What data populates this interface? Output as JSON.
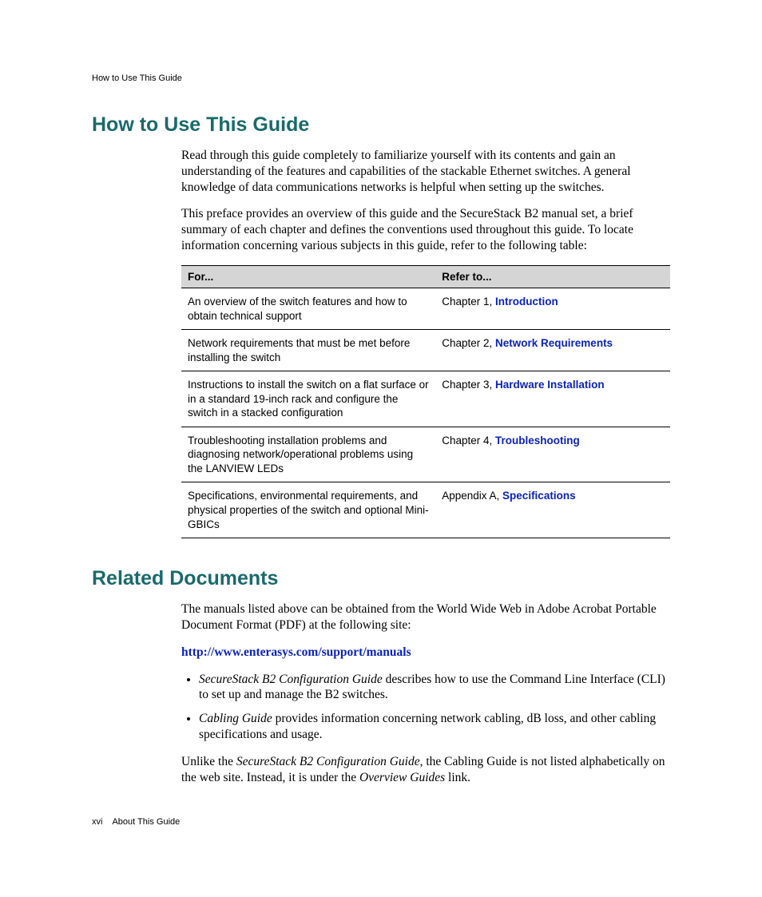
{
  "header": {
    "running": "How to Use This Guide"
  },
  "section1": {
    "title": "How to Use This Guide",
    "para1": "Read through this guide completely to familiarize yourself with its contents and gain an understanding of the features and capabilities of the stackable Ethernet switches. A general knowledge of data communications networks is helpful when setting up the switches.",
    "para2": "This preface provides an overview of this guide and the SecureStack B2 manual set, a brief summary of each chapter and defines the conventions used throughout this guide. To locate information concerning various subjects in this guide, refer to the following table:"
  },
  "table": {
    "head_for": "For...",
    "head_refer": "Refer to...",
    "rows": [
      {
        "for": "An overview of the switch features and how to obtain technical support",
        "ref_prefix": "Chapter 1, ",
        "ref_link": "Introduction"
      },
      {
        "for": "Network requirements that must be met before installing the switch",
        "ref_prefix": "Chapter 2, ",
        "ref_link": "Network Requirements"
      },
      {
        "for": "Instructions to install the switch on a flat surface or in a standard 19-inch rack and configure the switch in a stacked configuration",
        "ref_prefix": "Chapter 3, ",
        "ref_link": "Hardware Installation"
      },
      {
        "for": "Troubleshooting installation problems and diagnosing network/operational problems using the LANVIEW LEDs",
        "ref_prefix": "Chapter 4, ",
        "ref_link": "Troubleshooting"
      },
      {
        "for": "Specifications, environmental requirements, and physical properties of the switch and optional Mini-GBICs",
        "ref_prefix": "Appendix A, ",
        "ref_link": "Specifications"
      }
    ]
  },
  "section2": {
    "title": "Related Documents",
    "para1": "The manuals listed above can be obtained from the World Wide Web in Adobe Acrobat Portable Document Format (PDF) at the following site:",
    "url": "http://www.enterasys.com/support/manuals",
    "bullet1_em": "SecureStack B2 Configuration Guide",
    "bullet1_rest": " describes how to use the Command Line Interface (CLI) to set up and manage the B2 switches.",
    "bullet2_em": "Cabling Guide",
    "bullet2_rest": " provides information concerning network cabling, dB loss, and other cabling specifications and usage.",
    "para2_a": "Unlike the ",
    "para2_em1": "SecureStack B2 Configuration Guide",
    "para2_b": ", the Cabling Guide is not listed alphabetically on the web site. Instead, it is under the ",
    "para2_em2": "Overview Guides",
    "para2_c": " link."
  },
  "footer": {
    "pagenum": "xvi",
    "label": "About This Guide"
  }
}
